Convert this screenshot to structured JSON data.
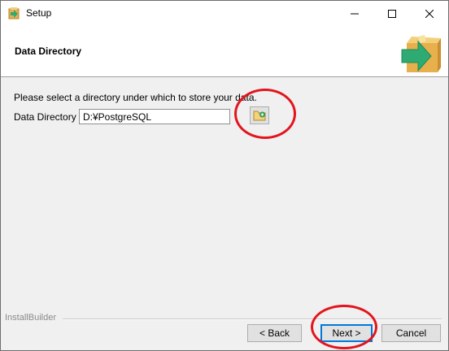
{
  "window": {
    "title": "Setup",
    "controls": {
      "minimize": "minimize-icon",
      "maximize": "maximize-icon",
      "close": "close-icon"
    }
  },
  "header": {
    "title": "Data Directory",
    "logo": "installer-box-arrow-icon"
  },
  "main": {
    "instruction": "Please select a directory under which to store your data.",
    "field_label": "Data Directory",
    "field_value": "D:¥PostgreSQL",
    "browse_icon": "folder-browse-icon"
  },
  "footer": {
    "brand": "InstallBuilder",
    "back_label": "< Back",
    "next_label": "Next >",
    "cancel_label": "Cancel"
  },
  "annotations": {
    "circle_color": "#e3141e"
  },
  "colors": {
    "accent": "#0078d7",
    "logo_box": "#e8b04c",
    "logo_arrow": "#2eaa73"
  }
}
